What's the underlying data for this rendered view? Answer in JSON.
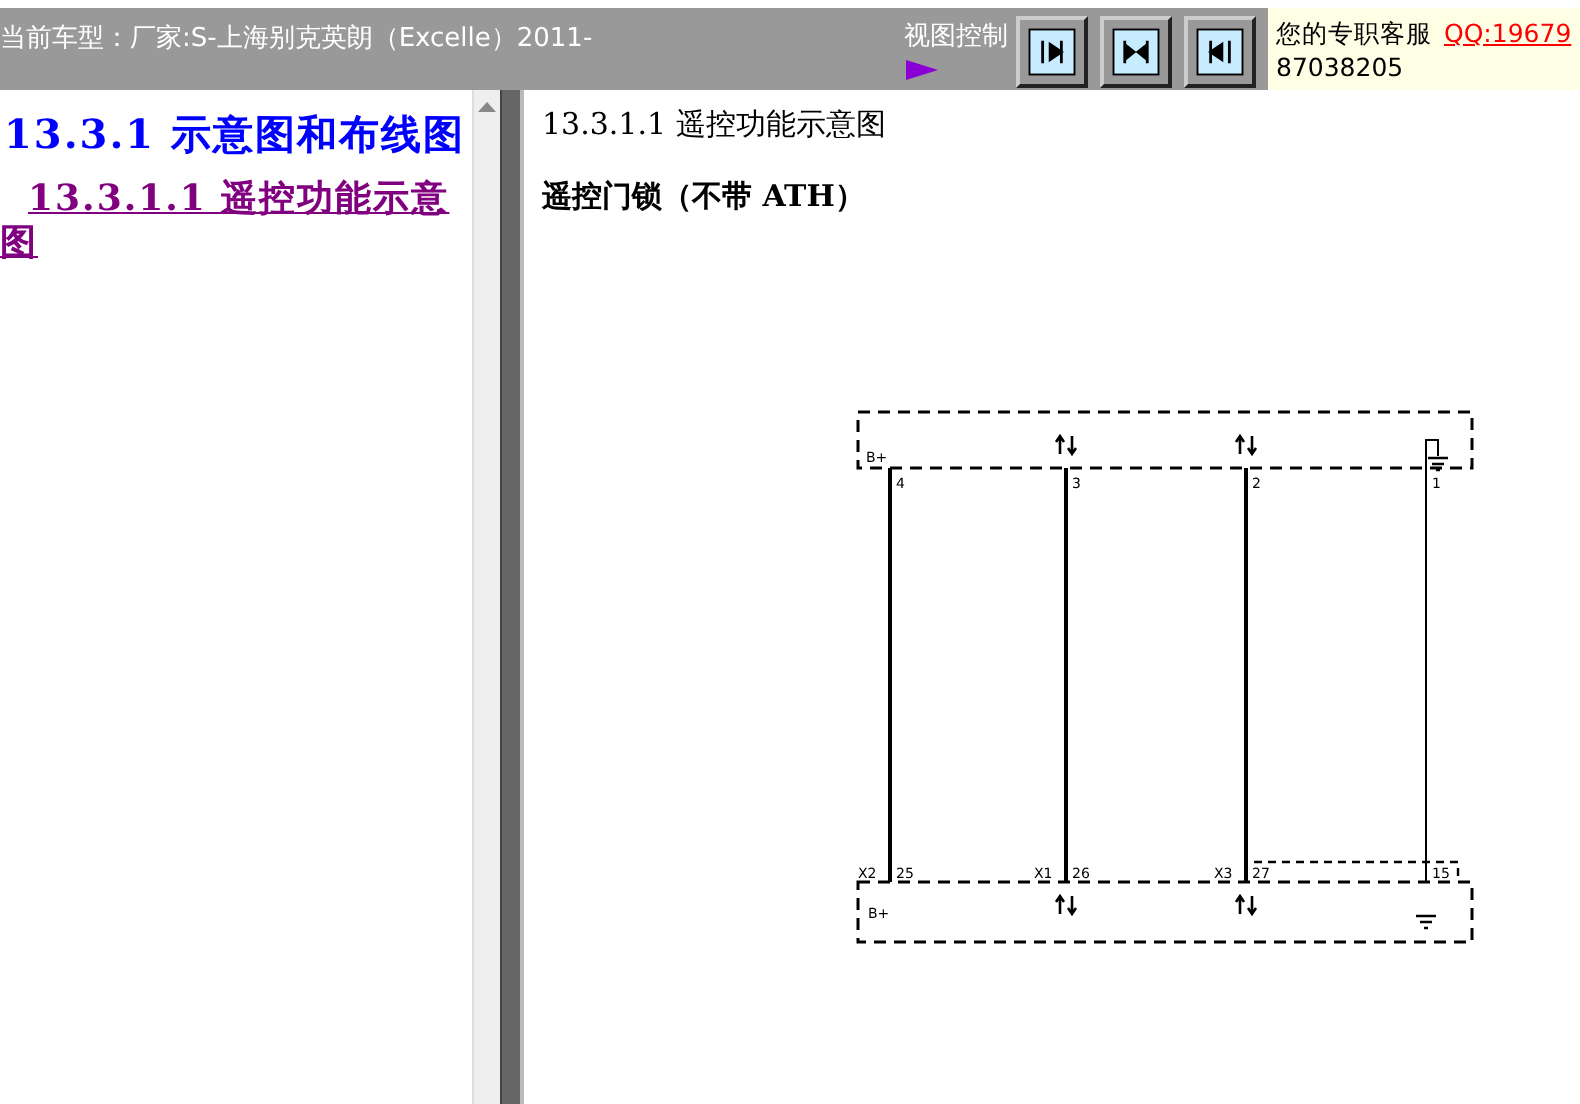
{
  "header": {
    "car_model": "当前车型：厂家:S-上海别克英朗（Excelle）2011-",
    "view_control_label": "视图控制",
    "support": {
      "label": "您的专职客服",
      "qq": "QQ:19679",
      "number": "87038205"
    }
  },
  "toc": {
    "items": [
      {
        "text": "13.3.1 示意图和布线图",
        "kind": "heading",
        "children": [
          {
            "text": "13.3.1.1 遥控功能示意图",
            "kind": "link",
            "visited": true
          }
        ]
      }
    ]
  },
  "content": {
    "title": "13.3.1.1 遥控功能示意图",
    "subtitle": "遥控门锁（不带 ATH）",
    "diagram": {
      "top_supply": "B+",
      "bottom_supply": "B+",
      "wires": [
        {
          "top_pin": "4",
          "bottom_pin": "25",
          "bottom_connector": "X2",
          "kind": "plain"
        },
        {
          "top_pin": "3",
          "bottom_pin": "26",
          "bottom_connector": "X1",
          "kind": "data"
        },
        {
          "top_pin": "2",
          "bottom_pin": "27",
          "bottom_connector": "X3",
          "kind": "data"
        },
        {
          "top_pin": "1",
          "bottom_pin": "15",
          "kind": "ground"
        }
      ]
    }
  }
}
